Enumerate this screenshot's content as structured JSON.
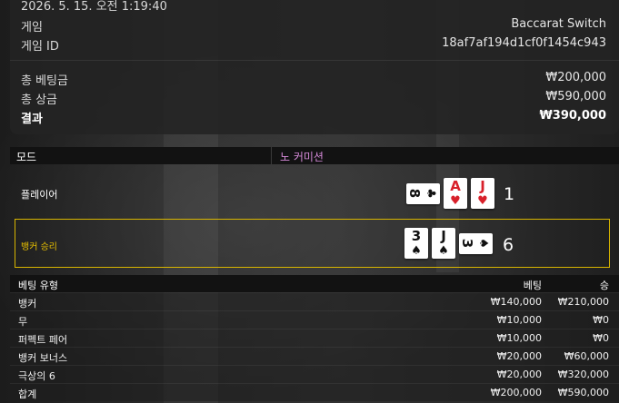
{
  "summary": {
    "datetime": "2026. 5. 15. 오전 1:19:40",
    "game_label": "게임",
    "game_value": "Baccarat Switch",
    "game_id_label": "게임 ID",
    "game_id_value": "18af7af194d1cf0f1454c943",
    "total_bet_label": "총 베팅금",
    "total_bet_value": "₩200,000",
    "total_win_label": "총 상금",
    "total_win_value": "₩590,000",
    "result_label": "결과",
    "result_value": "₩390,000"
  },
  "mode": {
    "label": "모드",
    "value": "노 커미션"
  },
  "player": {
    "name": "플레이어",
    "score": "1",
    "cards": [
      {
        "rank": "8",
        "suit": "♣",
        "orientation": "sideways"
      },
      {
        "rank": "A",
        "suit": "♥",
        "orientation": "upright"
      },
      {
        "rank": "J",
        "suit": "♥",
        "orientation": "upright"
      }
    ]
  },
  "banker": {
    "name": "뱅커 승리",
    "highlight_color": "#d8b500",
    "score": "6",
    "cards": [
      {
        "rank": "3",
        "suit": "♠",
        "orientation": "upright"
      },
      {
        "rank": "J",
        "suit": "♠",
        "orientation": "upright"
      },
      {
        "rank": "3",
        "suit": "♠",
        "orientation": "sideways"
      }
    ]
  },
  "bets_table": {
    "headers": [
      "베팅 유형",
      "베팅",
      "승"
    ],
    "rows": [
      [
        "뱅커",
        "₩140,000",
        "₩210,000"
      ],
      [
        "무",
        "₩10,000",
        "₩0"
      ],
      [
        "퍼펙트 페어",
        "₩10,000",
        "₩0"
      ],
      [
        "뱅커 보너스",
        "₩20,000",
        "₩60,000"
      ],
      [
        "극상의 6",
        "₩20,000",
        "₩320,000"
      ],
      [
        "합계",
        "₩200,000",
        "₩590,000"
      ]
    ]
  },
  "colors": {
    "mode_value": "#d58ad8",
    "banker_label": "#e8c000",
    "red_suit": "#d8202a"
  }
}
